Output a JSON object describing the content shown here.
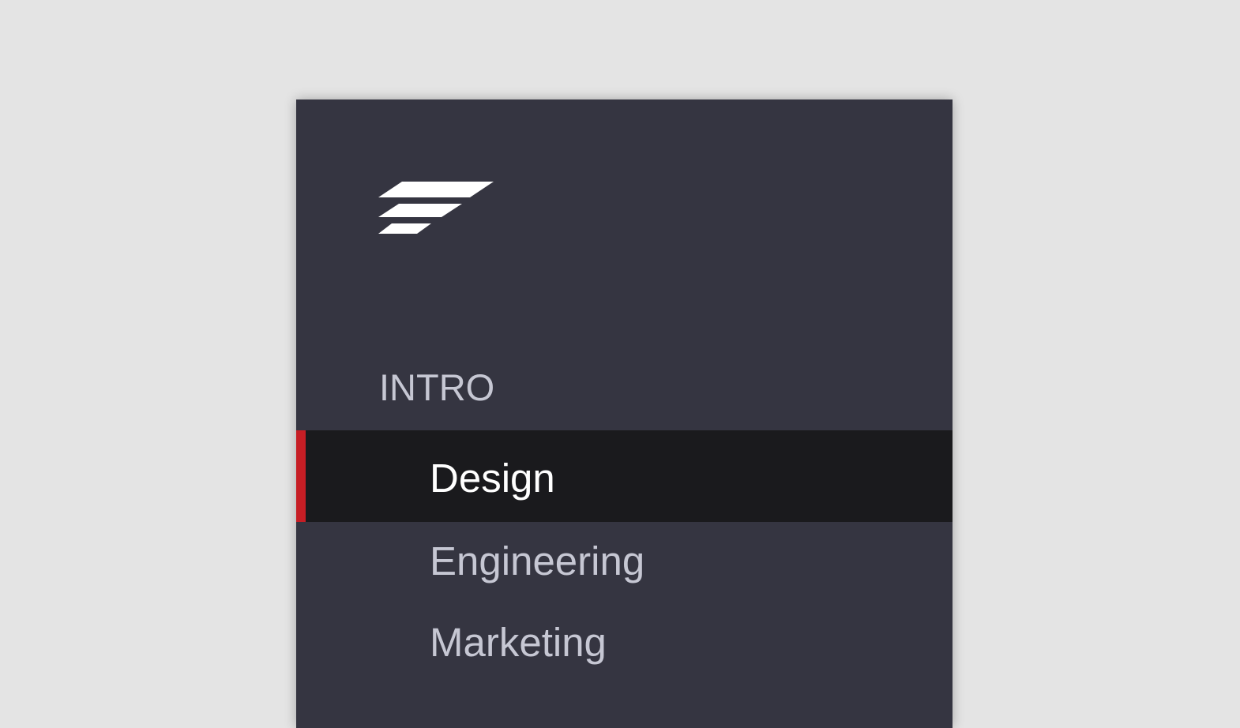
{
  "sidebar": {
    "logo_icon": "stacked-stripes-logo",
    "section": {
      "label": "INTRO"
    },
    "items": [
      {
        "label": "Design",
        "active": true
      },
      {
        "label": "Engineering",
        "active": false
      },
      {
        "label": "Marketing",
        "active": false
      }
    ]
  },
  "colors": {
    "background": "#e4e4e4",
    "sidebar_bg": "#353541",
    "active_bg": "#1a1a1d",
    "accent": "#c61e25",
    "text_muted": "#c6c7d3",
    "text_active": "#ffffff"
  }
}
